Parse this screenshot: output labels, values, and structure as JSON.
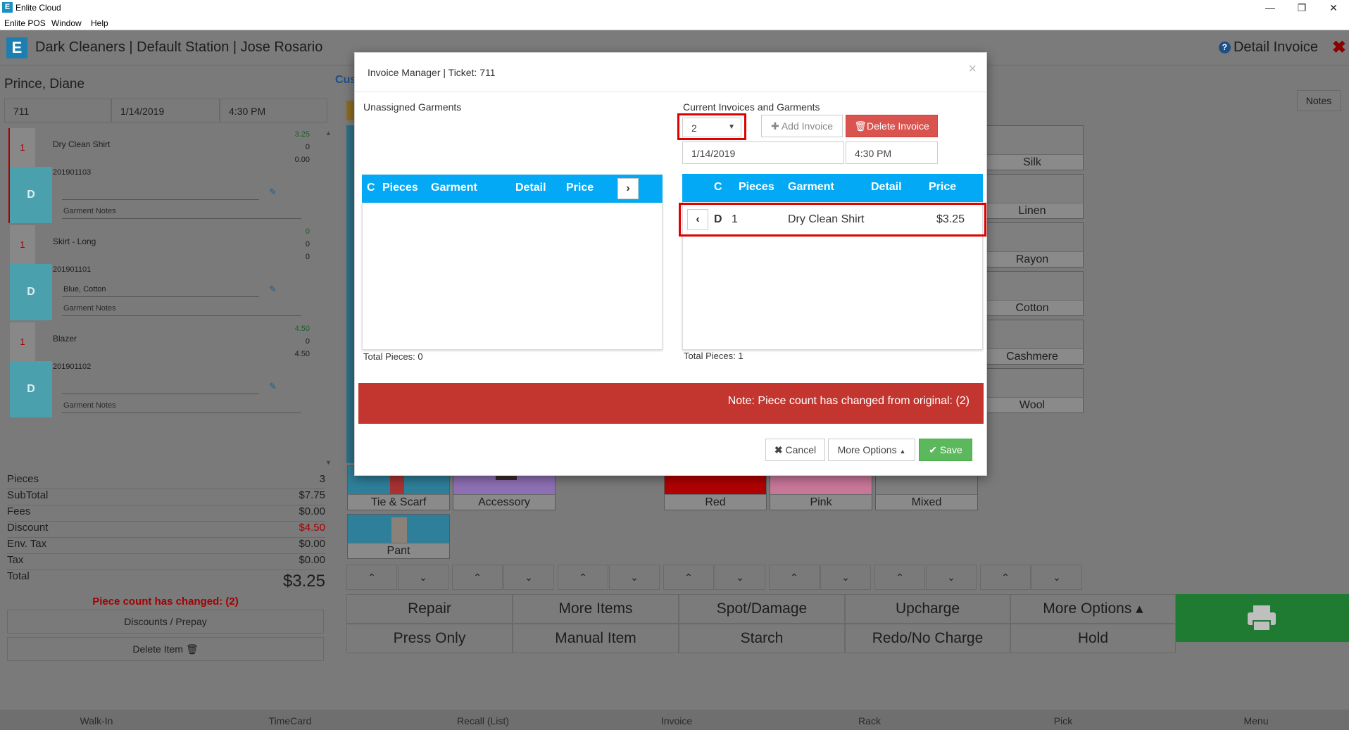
{
  "window": {
    "title": "Enlite Cloud",
    "menu": [
      "Enlite POS",
      "Window",
      "Help"
    ]
  },
  "header": {
    "title": "Dark Cleaners | Default Station | Jose Rosario",
    "detail": "Detail Invoice"
  },
  "customer": {
    "name": "Prince, Diane",
    "ticket": "711",
    "date": "1/14/2019",
    "time": "4:30 PM"
  },
  "garments": [
    {
      "qty": "1",
      "name": "Dry Clean Shirt",
      "code": "201901103",
      "note": "",
      "notes_label": "Garment Notes",
      "type": "D",
      "p1": "3.25",
      "p2": "0",
      "p3": "0.00"
    },
    {
      "qty": "1",
      "name": "Skirt - Long",
      "code": "201901101",
      "note": "Blue, Cotton",
      "notes_label": "Garment Notes",
      "type": "D",
      "p1": "0",
      "p2": "0",
      "p3": "0"
    },
    {
      "qty": "1",
      "name": "Blazer",
      "code": "201901102",
      "note": "",
      "notes_label": "Garment Notes",
      "type": "D",
      "p1": "4.50",
      "p2": "0",
      "p3": "4.50"
    }
  ],
  "totals": {
    "pieces_label": "Pieces",
    "pieces": "3",
    "subtotal_label": "SubTotal",
    "subtotal": "$7.75",
    "fees_label": "Fees",
    "fees": "$0.00",
    "discount_label": "Discount",
    "discount": "$4.50",
    "envtax_label": "Env. Tax",
    "envtax": "$0.00",
    "tax_label": "Tax",
    "tax": "$0.00",
    "total_label": "Total",
    "total": "$3.25"
  },
  "left_warning": "Piece count has changed: (2)",
  "left_buttons": {
    "discounts": "Discounts / Prepay",
    "delete": "Delete Item"
  },
  "right": {
    "notes": "Notes",
    "fabric_tiles": [
      "Silk",
      "Linen",
      "Rayon",
      "Cotton",
      "Cashmere",
      "Wool"
    ],
    "category_tiles": [
      "Tie & Scarf",
      "Accessory",
      "Pant"
    ],
    "color_tiles": [
      {
        "label": "Red",
        "color": "#c00000"
      },
      {
        "label": "Pink",
        "color": "#d07aa0"
      },
      {
        "label": "Mixed",
        "color": "#7f7f7f"
      }
    ],
    "actions_row1": [
      "Repair",
      "More Items",
      "Spot/Damage",
      "Upcharge",
      "More Options ▴"
    ],
    "actions_row2": [
      "Press Only",
      "Manual Item",
      "Starch",
      "Redo/No Charge",
      "Hold"
    ],
    "partial_label": "Cus"
  },
  "bottom_nav": [
    "Walk-In",
    "TimeCard",
    "Recall (List)",
    "Invoice",
    "Rack",
    "Pick",
    "Menu"
  ],
  "modal": {
    "title": "Invoice Manager | Ticket: 711",
    "unassigned_label": "Unassigned Garments",
    "current_label": "Current Invoices and Garments",
    "invoice_select": "2",
    "add_invoice": "Add Invoice",
    "delete_invoice": "Delete Invoice",
    "date": "1/14/2019",
    "time": "4:30 PM",
    "columns": [
      "C",
      "Pieces",
      "Garment",
      "Detail",
      "Price"
    ],
    "left_total": "Total Pieces: 0",
    "right_total": "Total Pieces: 1",
    "row": {
      "c": "D",
      "pieces": "1",
      "garment": "Dry Clean Shirt",
      "detail": "",
      "price": "$3.25"
    },
    "note": "Note: Piece count has changed from original: (2)",
    "cancel": "Cancel",
    "more_options": "More Options",
    "save": "Save"
  }
}
